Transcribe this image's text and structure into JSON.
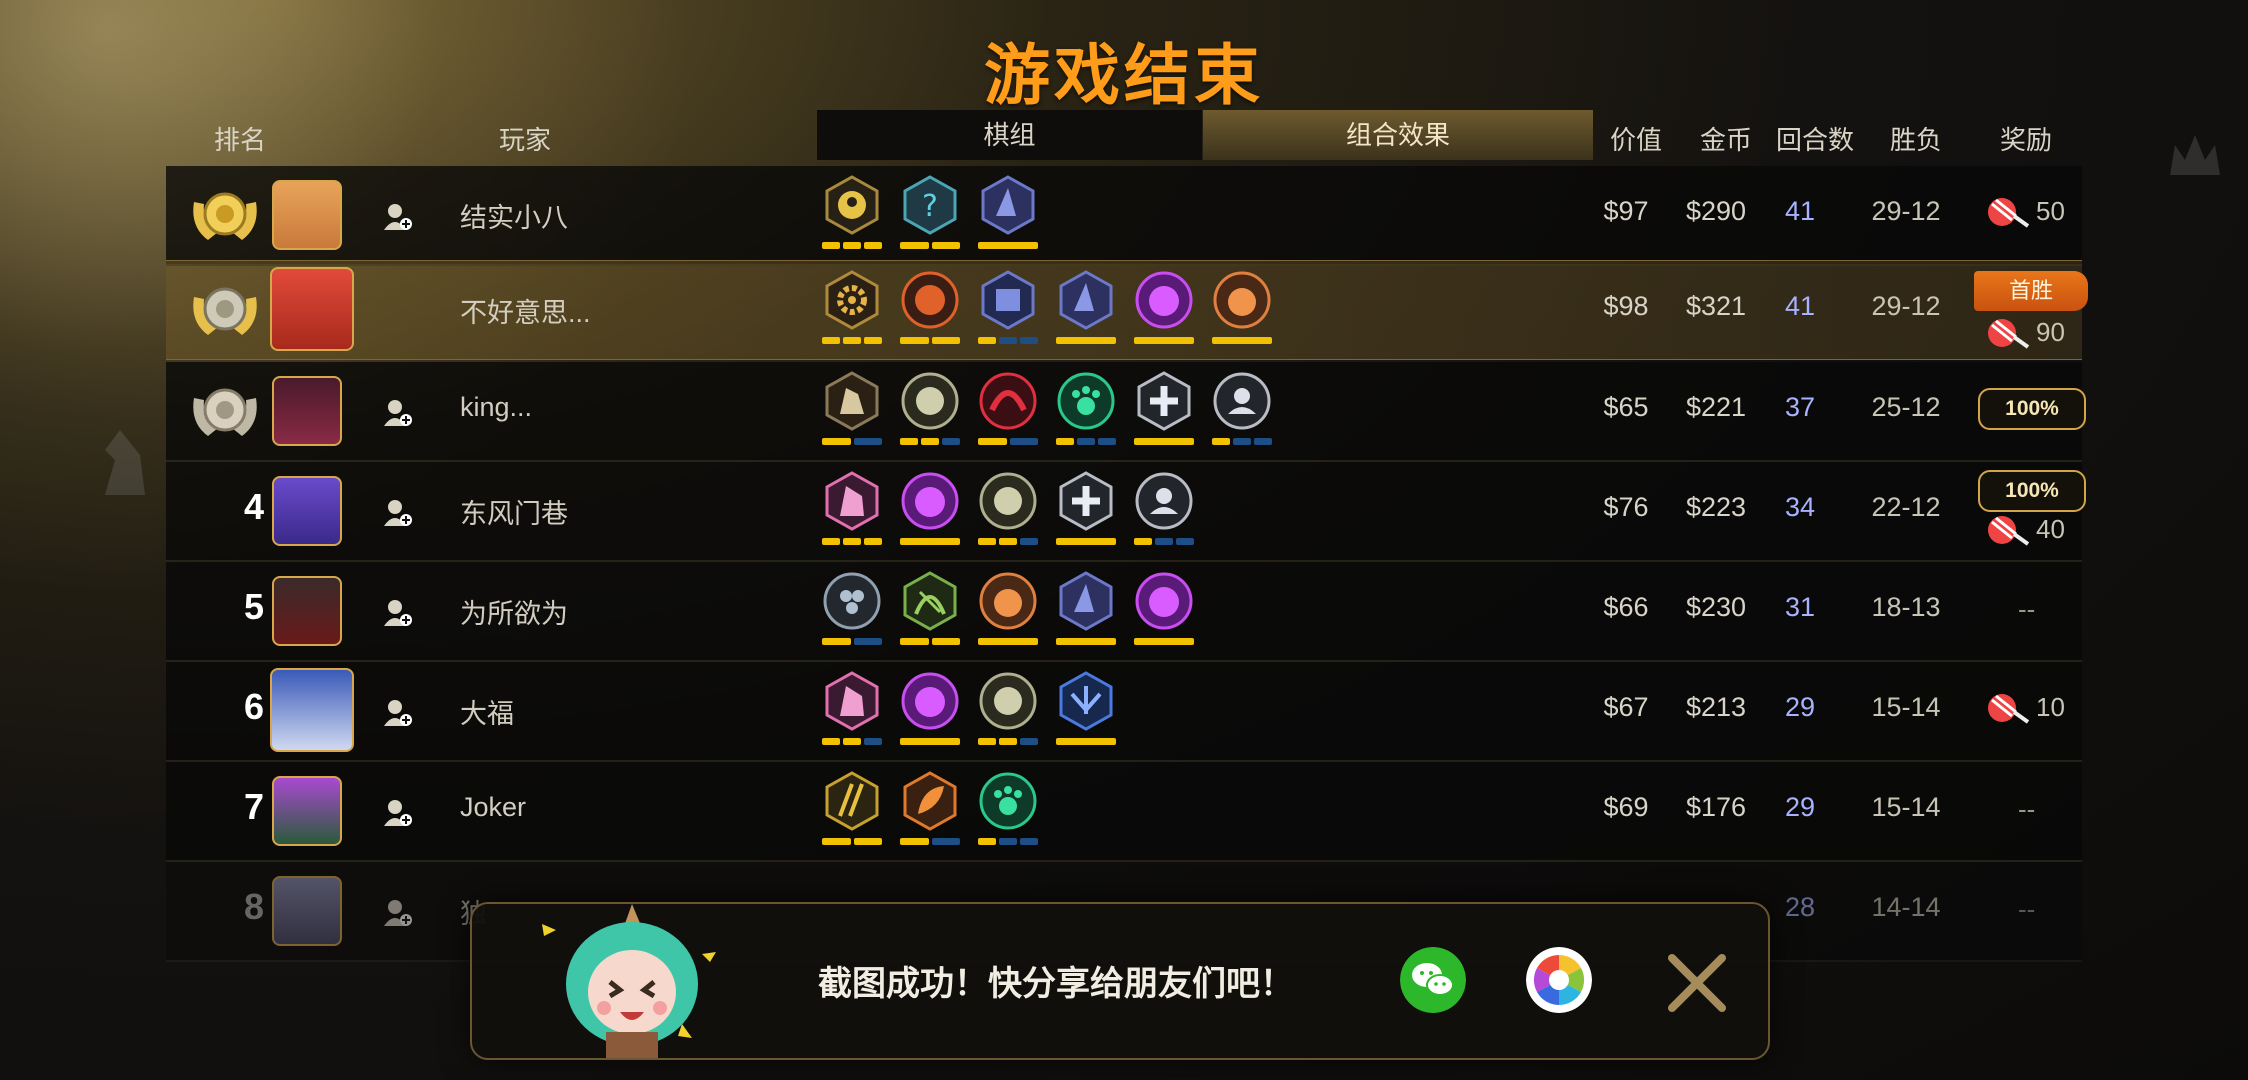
{
  "title": "游戏结束",
  "headers": {
    "rank": "排名",
    "player": "玩家",
    "pieces_tab": "棋组",
    "combo_tab": "组合效果",
    "value": "价值",
    "gold": "金币",
    "rounds": "回合数",
    "win_loss": "胜负",
    "reward": "奖励"
  },
  "rows": [
    {
      "rank": "1",
      "name": "结实小八",
      "value": "$97",
      "gold": "$290",
      "rounds": "41",
      "win_loss": "29-12",
      "reward_amount": "50",
      "reward_type": "candy"
    },
    {
      "rank": "2",
      "name": "不好意思...",
      "value": "$98",
      "gold": "$321",
      "rounds": "41",
      "win_loss": "29-12",
      "reward_amount": "90",
      "reward_type": "candy",
      "badge": "首胜"
    },
    {
      "rank": "3",
      "name": "king...",
      "value": "$65",
      "gold": "$221",
      "rounds": "37",
      "win_loss": "25-12",
      "reward_amount": "100%",
      "reward_type": "percent"
    },
    {
      "rank": "4",
      "name": "东风门巷",
      "value": "$76",
      "gold": "$223",
      "rounds": "34",
      "win_loss": "22-12",
      "reward_amount": "40",
      "reward_type": "percent+candy",
      "reward_pct": "100%"
    },
    {
      "rank": "5",
      "name": "为所欲为",
      "value": "$66",
      "gold": "$230",
      "rounds": "31",
      "win_loss": "18-13",
      "reward_amount": "--",
      "reward_type": "none"
    },
    {
      "rank": "6",
      "name": "大福",
      "value": "$67",
      "gold": "$213",
      "rounds": "29",
      "win_loss": "15-14",
      "reward_amount": "10",
      "reward_type": "candy"
    },
    {
      "rank": "7",
      "name": "Joker",
      "value": "$69",
      "gold": "$176",
      "rounds": "29",
      "win_loss": "15-14",
      "reward_amount": "--",
      "reward_type": "none"
    },
    {
      "rank": "8",
      "name": "独",
      "value": "",
      "gold": "",
      "rounds": "28",
      "win_loss": "14-14",
      "reward_amount": "--",
      "reward_type": "none"
    }
  ],
  "toast": {
    "message": "截图成功！快分享给朋友们吧！",
    "wechat_icon": "wechat-icon",
    "moments_icon": "moments-icon",
    "close_icon": "close-icon"
  },
  "colors": {
    "title": "#ff9d1a",
    "rounds": "#a8b2ff",
    "pip_active": "#f2c200",
    "pip_inactive": "#1d4f86"
  }
}
